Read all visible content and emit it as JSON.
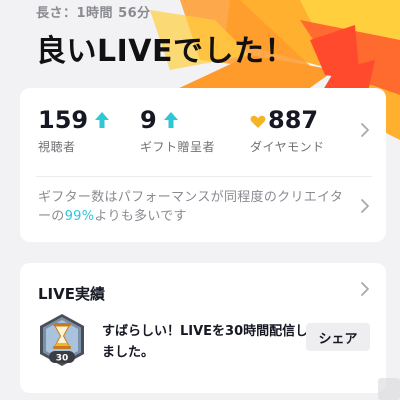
{
  "header": {
    "duration_label": "長さ：",
    "duration_value": "1時間 56分",
    "title": "良いLIVEでした！"
  },
  "stats": [
    {
      "value": "159",
      "label": "視聴者",
      "trend": "up",
      "icon": "up-arrow-icon"
    },
    {
      "value": "9",
      "label": "ギフト贈呈者",
      "trend": "up",
      "icon": "up-arrow-icon"
    },
    {
      "value": "887",
      "label": "ダイヤモンド",
      "icon": "heart-diamond-icon"
    }
  ],
  "gifter": {
    "text_before": "ギフター数はパフォーマンスが同程度のクリエイターの",
    "percent": "99%",
    "text_after": "よりも多いです"
  },
  "achievements": {
    "title": "LIVE実績",
    "badge_number": "30",
    "message": "すばらしい！LIVEを30時間配信しました。",
    "share_label": "シェア"
  },
  "colors": {
    "accent_teal": "#2fc6d6",
    "burst_orange": "#ff9b2b",
    "burst_red": "#ff4a2e",
    "burst_yellow": "#ffcf3d",
    "gold": "#f5b425"
  }
}
